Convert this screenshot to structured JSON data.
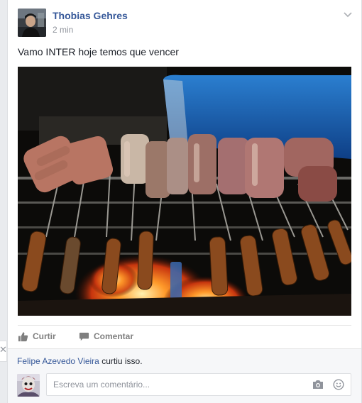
{
  "post": {
    "author": "Thobias Gehres",
    "time": "2 min",
    "text": "Vamo INTER hoje temos que vencer"
  },
  "actions": {
    "like_label": "Curtir",
    "comment_label": "Comentar"
  },
  "likes": {
    "name": "Felipe Azevedo Vieira",
    "suffix": " curtiu isso."
  },
  "comment_box": {
    "placeholder": "Escreva um comentário..."
  },
  "icons": {
    "options": "chevron-down-icon",
    "like": "thumbs-up-icon",
    "comment": "speech-bubble-icon",
    "camera": "camera-icon",
    "emoji": "smiley-icon",
    "close": "close-icon"
  },
  "colors": {
    "link": "#365899",
    "muted": "#90949c",
    "action_gray": "#7f7f7f"
  }
}
